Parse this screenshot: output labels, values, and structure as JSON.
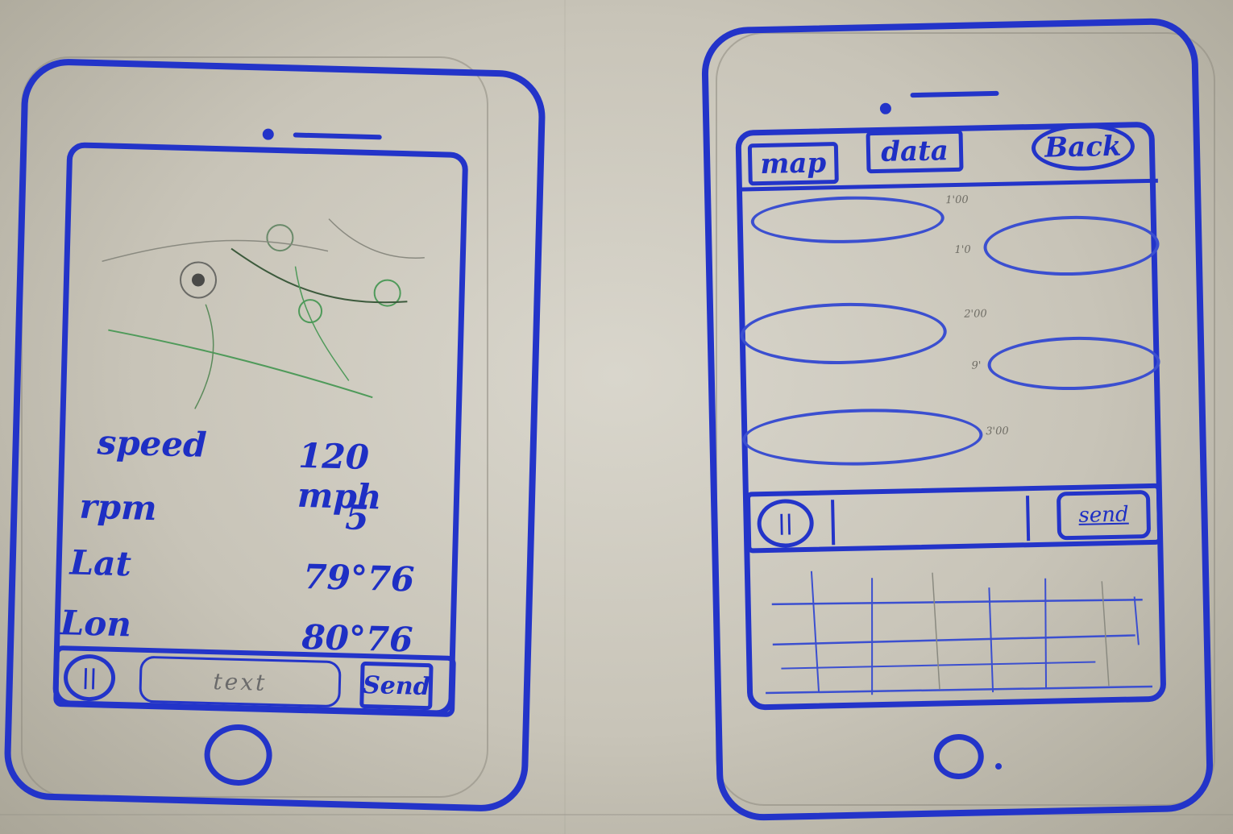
{
  "left_phone": {
    "stats": [
      {
        "label": "speed",
        "value": "120 mph"
      },
      {
        "label": "rpm",
        "value": "5"
      },
      {
        "label": "Lat",
        "value": "79°76"
      },
      {
        "label": "Lon",
        "value": "80°76"
      }
    ],
    "bottom_bar": {
      "mic_label": "||",
      "text_placeholder": "text",
      "send_label": "Send"
    }
  },
  "right_phone": {
    "tabs": {
      "map": "map",
      "data": "data",
      "back": "Back"
    },
    "times": [
      "1'00",
      "1'0",
      "2'00",
      "9'",
      "3'00"
    ],
    "bottom_bar": {
      "mic_label": "||",
      "send_label": "send"
    }
  },
  "colors": {
    "ink": "#2334c9",
    "paper": "#d4d1c7"
  }
}
